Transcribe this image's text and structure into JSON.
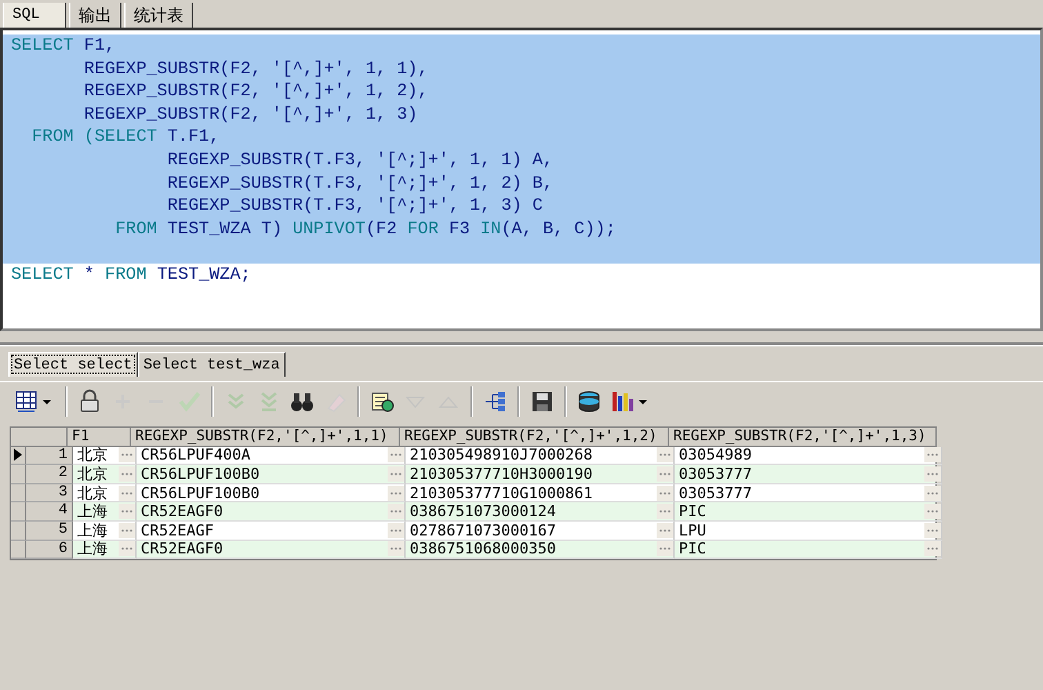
{
  "tabs": [
    {
      "label": "SQL",
      "selected": true
    },
    {
      "label": "输出",
      "selected": false
    },
    {
      "label": "统计表",
      "selected": false
    }
  ],
  "editor": {
    "lines": [
      {
        "selected": true,
        "tokens": [
          {
            "kind": "keyword",
            "text": "SELECT"
          },
          {
            "kind": "text",
            "text": " F1,"
          }
        ]
      },
      {
        "selected": true,
        "tokens": [
          {
            "kind": "text",
            "text": "       REGEXP_SUBSTR(F2, '[^,]+', 1, 1),"
          }
        ]
      },
      {
        "selected": true,
        "tokens": [
          {
            "kind": "text",
            "text": "       REGEXP_SUBSTR(F2, '[^,]+', 1, 2),"
          }
        ]
      },
      {
        "selected": true,
        "tokens": [
          {
            "kind": "text",
            "text": "       REGEXP_SUBSTR(F2, '[^,]+', 1, 3)"
          }
        ]
      },
      {
        "selected": true,
        "tokens": [
          {
            "kind": "keyword",
            "text": "  FROM (SELECT"
          },
          {
            "kind": "text",
            "text": " T.F1,"
          }
        ]
      },
      {
        "selected": true,
        "tokens": [
          {
            "kind": "text",
            "text": "               REGEXP_SUBSTR(T.F3, '[^;]+', 1, 1) A,"
          }
        ]
      },
      {
        "selected": true,
        "tokens": [
          {
            "kind": "text",
            "text": "               REGEXP_SUBSTR(T.F3, '[^;]+', 1, 2) B,"
          }
        ]
      },
      {
        "selected": true,
        "tokens": [
          {
            "kind": "text",
            "text": "               REGEXP_SUBSTR(T.F3, '[^;]+', 1, 3) C"
          }
        ]
      },
      {
        "selected": true,
        "tokens": [
          {
            "kind": "keyword",
            "text": "          FROM"
          },
          {
            "kind": "text",
            "text": " TEST_WZA T) "
          },
          {
            "kind": "keyword",
            "text": "UNPIVOT"
          },
          {
            "kind": "text",
            "text": "(F2 "
          },
          {
            "kind": "keyword",
            "text": "FOR"
          },
          {
            "kind": "text",
            "text": " F3 "
          },
          {
            "kind": "keyword",
            "text": "IN"
          },
          {
            "kind": "text",
            "text": "(A, B, C));"
          }
        ]
      },
      {
        "selected": true
      },
      {
        "selected": false,
        "tokens": [
          {
            "kind": "keyword",
            "text": "SELECT"
          },
          {
            "kind": "text",
            "text": " * "
          },
          {
            "kind": "keyword",
            "text": "FROM"
          },
          {
            "kind": "text",
            "text": " TEST_WZA;"
          }
        ]
      }
    ]
  },
  "result_tabs": [
    {
      "label": "Select select",
      "selected": true
    },
    {
      "label": "Select test_wza",
      "selected": false
    }
  ],
  "toolbar": [
    {
      "kind": "grid",
      "disabled": false
    },
    {
      "kind": "sep"
    },
    {
      "kind": "lock",
      "disabled": false
    },
    {
      "kind": "plus",
      "disabled": true
    },
    {
      "kind": "minus",
      "disabled": true
    },
    {
      "kind": "check",
      "disabled": true
    },
    {
      "kind": "sep"
    },
    {
      "kind": "next",
      "disabled": true
    },
    {
      "kind": "last",
      "disabled": true
    },
    {
      "kind": "find",
      "disabled": false
    },
    {
      "kind": "eraser",
      "disabled": true
    },
    {
      "kind": "sep"
    },
    {
      "kind": "query",
      "disabled": false
    },
    {
      "kind": "down",
      "disabled": true
    },
    {
      "kind": "up",
      "disabled": true
    },
    {
      "kind": "sep"
    },
    {
      "kind": "tree",
      "disabled": false
    },
    {
      "kind": "sep"
    },
    {
      "kind": "save",
      "disabled": false
    },
    {
      "kind": "sep"
    },
    {
      "kind": "db",
      "disabled": false
    },
    {
      "kind": "chart",
      "disabled": false
    }
  ],
  "table": {
    "columns": [
      "F1",
      "REGEXP_SUBSTR(F2,'[^,]+',1,1)",
      "REGEXP_SUBSTR(F2,'[^,]+',1,2)",
      "REGEXP_SUBSTR(F2,'[^,]+',1,3)"
    ],
    "rows": [
      {
        "number": "1",
        "current": true,
        "cells": [
          "北京",
          "CR56LPUF400A",
          "210305498910J7000268",
          "03054989"
        ]
      },
      {
        "number": "2",
        "current": false,
        "cells": [
          "北京",
          "CR56LPUF100B0",
          "210305377710H3000190",
          "03053777"
        ]
      },
      {
        "number": "3",
        "current": false,
        "cells": [
          "北京",
          "CR56LPUF100B0",
          "210305377710G1000861",
          "03053777"
        ]
      },
      {
        "number": "4",
        "current": false,
        "cells": [
          "上海",
          "CR52EAGF0",
          "0386751073000124",
          "PIC"
        ]
      },
      {
        "number": "5",
        "current": false,
        "cells": [
          "上海",
          "CR52EAGF",
          "0278671073000167",
          "LPU"
        ]
      },
      {
        "number": "6",
        "current": false,
        "cells": [
          "上海",
          "CR52EAGF0",
          "0386751068000350",
          "PIC"
        ]
      }
    ]
  }
}
